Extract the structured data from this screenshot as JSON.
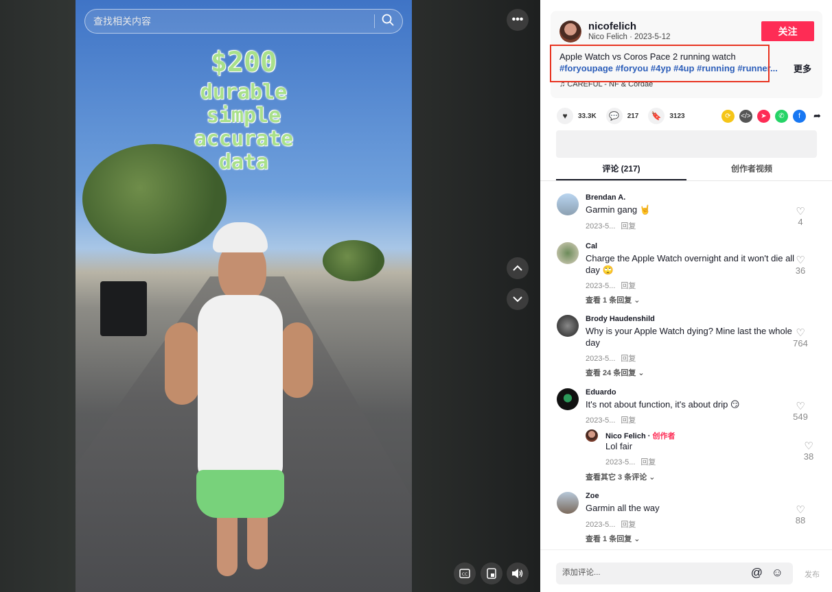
{
  "search": {
    "placeholder": "查找相关内容"
  },
  "video": {
    "overlay_lines": [
      "$200",
      "durable",
      "simple",
      "accurate",
      "data"
    ]
  },
  "author": {
    "username": "nicofelich",
    "subline": "Nico Felich · 2023-5-12",
    "follow_label": "关注"
  },
  "post": {
    "description": "Apple Watch vs Coros Pace 2 running watch",
    "tags": "#foryoupage #foryou #4yp #4up #running #runner...",
    "more_label": "更多",
    "music": "CAREFUL - NF & Cordae"
  },
  "stats": {
    "likes": "33.3K",
    "comments": "217",
    "saves": "3123"
  },
  "tabs": {
    "comments": "评论 (217)",
    "creator_videos": "创作者视频"
  },
  "comments": [
    {
      "name": "Brendan A.",
      "text": "Garmin gang 🤘",
      "date": "2023-5...",
      "reply": "回复",
      "likes": "4",
      "view_replies": ""
    },
    {
      "name": "Cal",
      "text": "Charge the Apple Watch overnight and it won't die all day 🙄",
      "date": "2023-5...",
      "reply": "回复",
      "likes": "36",
      "view_replies": "查看 1 条回复"
    },
    {
      "name": "Brody Haudenshild",
      "text": "Why is your Apple Watch dying? Mine last the whole day",
      "date": "2023-5...",
      "reply": "回复",
      "likes": "764",
      "view_replies": "查看 24 条回复"
    },
    {
      "name": "Eduardo",
      "text": "It's not about function, it's about drip 😏",
      "date": "2023-5...",
      "reply": "回复",
      "likes": "549",
      "view_replies": "查看其它 3 条评论"
    },
    {
      "name": "Zoe",
      "text": "Garmin all the way",
      "date": "2023-5...",
      "reply": "回复",
      "likes": "88",
      "view_replies": "查看 1 条回复"
    }
  ],
  "reply": {
    "name": "Nico Felich",
    "tag": "创作者",
    "text": "Lol fair",
    "date": "2023-5...",
    "reply": "回复",
    "likes": "38"
  },
  "composer": {
    "placeholder": "添加评论...",
    "post_label": "发布"
  },
  "colors": {
    "accent": "#fe2c55",
    "tag_blue": "#2b5db9",
    "highlight": "#e8321f"
  }
}
